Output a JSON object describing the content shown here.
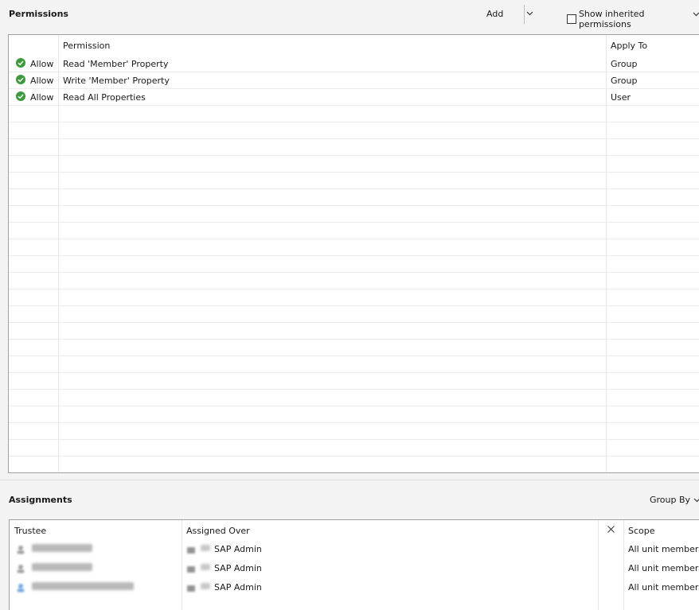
{
  "permissions": {
    "title": "Permissions",
    "add_label": "Add",
    "show_inherited_label": "Show inherited permissions",
    "show_inherited_checked": false,
    "columns": {
      "type": "",
      "permission": "Permission",
      "apply_to": "Apply To"
    },
    "rows": [
      {
        "type": "Allow",
        "permission": "Read 'Member' Property",
        "apply_to": "Group"
      },
      {
        "type": "Allow",
        "permission": "Write 'Member' Property",
        "apply_to": "Group"
      },
      {
        "type": "Allow",
        "permission": "Read All Properties",
        "apply_to": "User"
      }
    ]
  },
  "assignments": {
    "title": "Assignments",
    "group_by_label": "Group By",
    "columns": {
      "trustee": "Trustee",
      "assigned_over": "Assigned Over",
      "scope": "Scope"
    },
    "rows": [
      {
        "trustee_icon": "user-icon",
        "assigned_over": "SAP Admin",
        "scope": "All unit members"
      },
      {
        "trustee_icon": "user-icon",
        "assigned_over": "SAP Admin",
        "scope": "All unit members"
      },
      {
        "trustee_icon": "group-icon",
        "assigned_over": "SAP Admin",
        "scope": "All unit members"
      }
    ]
  },
  "colors": {
    "allow_green": "#3c9a3c",
    "accent_blue": "#3b7fd1"
  }
}
